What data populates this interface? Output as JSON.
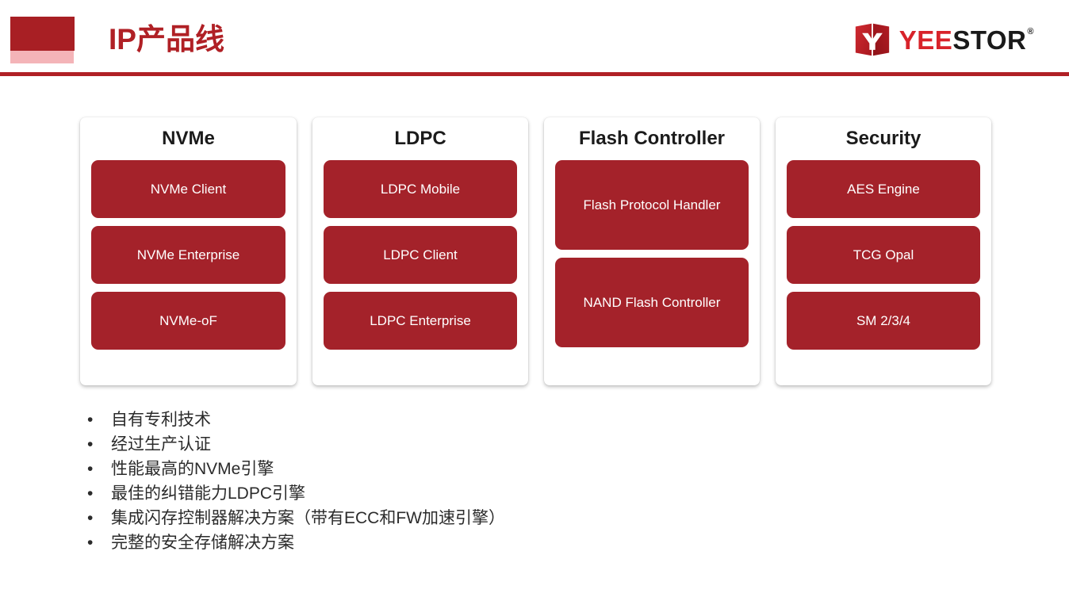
{
  "header": {
    "title": "IP产品线",
    "accent_dark": "#a81f24",
    "accent_light": "#f4b4b8",
    "rule_color": "#b02025",
    "logo": {
      "mark_name": "yeestor-logo-mark",
      "text_primary": "YEE",
      "text_secondary": "STOR",
      "registered_mark": "®",
      "primary_color": "#d8232a",
      "secondary_color": "#1a1a1a"
    }
  },
  "cards": [
    {
      "title": "NVMe",
      "items": [
        "NVMe Client",
        "NVMe Enterprise",
        "NVMe-oF"
      ]
    },
    {
      "title": "LDPC",
      "items": [
        "LDPC Mobile",
        "LDPC Client",
        "LDPC Enterprise"
      ]
    },
    {
      "title": "Flash Controller",
      "items": [
        "Flash Protocol Handler",
        "NAND Flash Controller"
      ]
    },
    {
      "title": "Security",
      "items": [
        "AES Engine",
        "TCG Opal",
        "SM 2/3/4"
      ]
    }
  ],
  "chip_color": "#a4222a",
  "bullets": [
    "自有专利技术",
    "经过生产认证",
    "性能最高的NVMe引擎",
    "最佳的纠错能力LDPC引擎",
    "集成闪存控制器解决方案（带有ECC和FW加速引擎）",
    "完整的安全存储解决方案"
  ]
}
